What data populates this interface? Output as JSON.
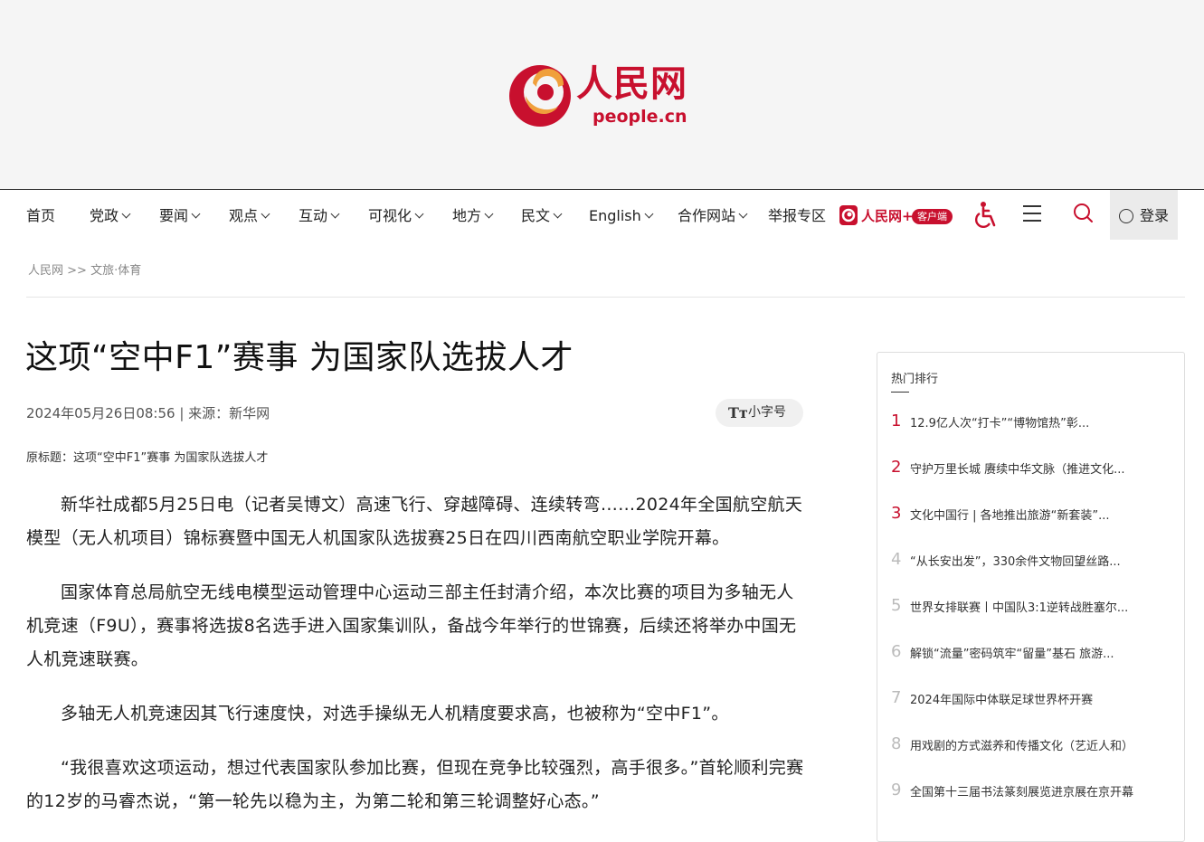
{
  "brand": {
    "name_cn": "人民网",
    "name_en": "people.cn",
    "red": "#c8102e"
  },
  "nav": {
    "items": [
      {
        "label": "首页",
        "dropdown": false
      },
      {
        "label": "党政",
        "dropdown": true
      },
      {
        "label": "要闻",
        "dropdown": true
      },
      {
        "label": "观点",
        "dropdown": true
      },
      {
        "label": "互动",
        "dropdown": true
      },
      {
        "label": "可视化",
        "dropdown": true
      },
      {
        "label": "地方",
        "dropdown": true
      },
      {
        "label": "民文",
        "dropdown": true
      },
      {
        "label": "English",
        "dropdown": true
      },
      {
        "label": "合作网站",
        "dropdown": true
      },
      {
        "label": "举报专区",
        "dropdown": false
      }
    ],
    "app_name": "人民网+",
    "app_badge": "客户端",
    "login_label": "登录",
    "icons": [
      "accessibility-icon",
      "menu-icon",
      "search-icon",
      "user-icon"
    ]
  },
  "breadcrumb": {
    "home": "人民网",
    "separator": ">>",
    "section": "文旅·体育"
  },
  "article": {
    "title": "这项“空中F1”赛事 为国家队选拔人才",
    "meta": "2024年05月26日08:56 | 来源：新华网",
    "font_size_label": "小字号",
    "font_size_icon": "Tт",
    "original_title": "原标题：这项“空中F1”赛事 为国家队选拔人才",
    "paragraphs": [
      "新华社成都5月25日电（记者吴博文）高速飞行、穿越障碍、连续转弯……2024年全国航空航天模型（无人机项目）锦标赛暨中国无人机国家队选拔赛25日在四川西南航空职业学院开幕。",
      "国家体育总局航空无线电模型运动管理中心运动三部主任封清介绍，本次比赛的项目为多轴无人机竞速（F9U），赛事将选拔8名选手进入国家集训队，备战今年举行的世锦赛，后续还将举办中国无人机竞速联赛。",
      "多轴无人机竞速因其飞行速度快，对选手操纵无人机精度要求高，也被称为“空中F1”。",
      "“我很喜欢这项运动，想过代表国家队参加比赛，但现在竞争比较强烈，高手很多。”首轮顺利完赛的12岁的马睿杰说，“第一轮先以稳为主，为第二轮和第三轮调整好心态。”"
    ]
  },
  "sidebar": {
    "title": "热门排行",
    "items": [
      {
        "rank": "1",
        "text": "12.9亿人次“打卡”“博物馆热”彰..."
      },
      {
        "rank": "2",
        "text": "守护万里长城 赓续中华文脉（推进文化..."
      },
      {
        "rank": "3",
        "text": "文化中国行 | 各地推出旅游“新套装”..."
      },
      {
        "rank": "4",
        "text": "“从长安出发”，330余件文物回望丝路..."
      },
      {
        "rank": "5",
        "text": "世界女排联赛丨中国队3:1逆转战胜塞尔..."
      },
      {
        "rank": "6",
        "text": "解锁“流量”密码筑牢“留量”基石 旅游..."
      },
      {
        "rank": "7",
        "text": "2024年国际中体联足球世界杯开赛"
      },
      {
        "rank": "8",
        "text": "用戏剧的方式滋养和传播文化（艺近人和）"
      },
      {
        "rank": "9",
        "text": "全国第十三届书法篆刻展览进京展在京开幕"
      }
    ]
  }
}
